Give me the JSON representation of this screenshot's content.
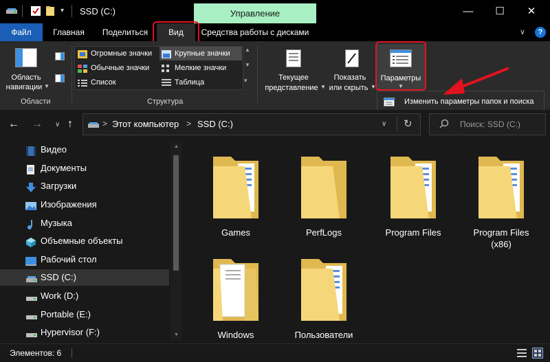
{
  "title_bar": {
    "context_tab": "Управление",
    "title": "SSD (C:)",
    "minimize": "—",
    "maximize": "☐",
    "close": "✕"
  },
  "tabs": [
    "Файл",
    "Главная",
    "Поделиться",
    "Вид",
    "Средства работы с дисками"
  ],
  "ribbon": {
    "nav_pane": {
      "line1": "Область",
      "line2": "навигации"
    },
    "panels_group": "Области",
    "layout": {
      "items": [
        "Огромные значки",
        "Крупные значки",
        "Обычные значки",
        "Мелкие значки",
        "Список",
        "Таблица"
      ],
      "group": "Структура"
    },
    "current_view": {
      "line1": "Текущее",
      "line2": "представление"
    },
    "show_hide": {
      "line1": "Показать",
      "line2": "или скрыть"
    },
    "options": {
      "label": "Параметры",
      "menu_item": "Изменить параметры папок и поиска"
    }
  },
  "address": {
    "segments": [
      "Этот компьютер",
      "SSD (C:)"
    ],
    "separator": ">",
    "search_placeholder": "Поиск: SSD (C:)"
  },
  "nav_items": [
    "Видео",
    "Документы",
    "Загрузки",
    "Изображения",
    "Музыка",
    "Объемные объекты",
    "Рабочий стол",
    "SSD (C:)",
    "Work (D:)",
    "Portable (E:)",
    "Hypervisor (F:)"
  ],
  "folders": [
    "Games",
    "PerfLogs",
    "Program Files",
    "Program Files (x86)",
    "Windows",
    "Пользователи"
  ],
  "status": {
    "items_count": "Элементов: 6"
  },
  "colors": {
    "accent": "#1b5eb5",
    "highlight_red": "#e0141e",
    "folder": "#f5d77a",
    "context_tab": "#a8f0c3"
  }
}
